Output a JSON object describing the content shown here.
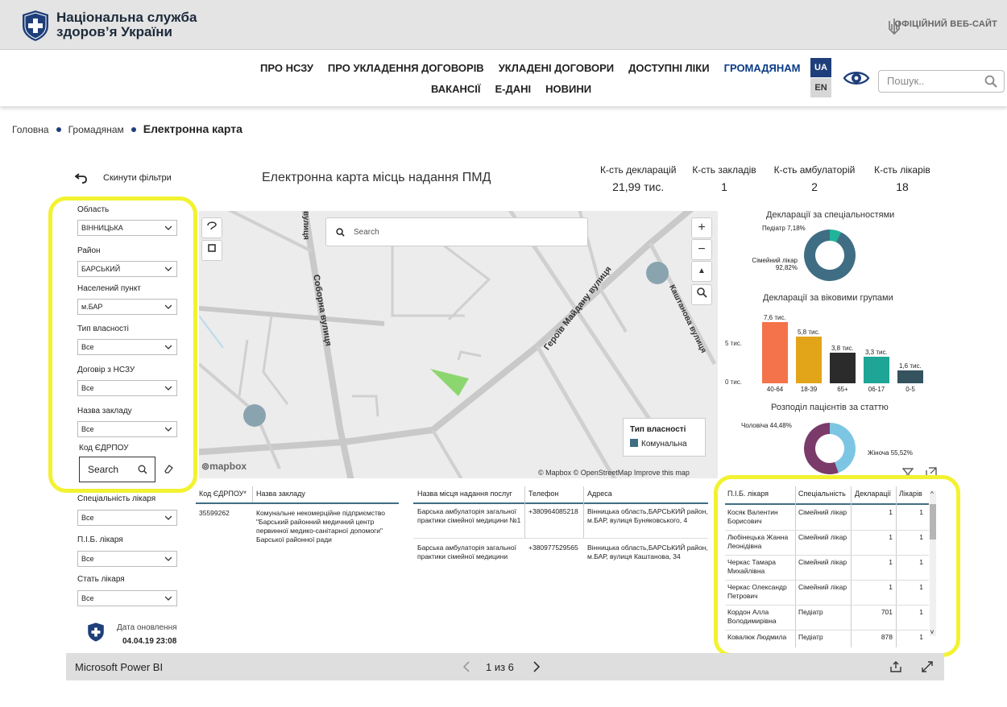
{
  "header": {
    "site_title_line1": "Національна служба",
    "site_title_line2": "здоров’я України",
    "official": "ОФІЦІЙНИЙ ВЕБ-САЙТ"
  },
  "nav": {
    "row1": [
      "ПРО НСЗУ",
      "ПРО УКЛАДЕННЯ ДОГОВОРІВ",
      "УКЛАДЕНІ ДОГОВОРИ",
      "ДОСТУПНІ ЛІКИ",
      "ГРОМАДЯНАМ"
    ],
    "row2": [
      "ВАКАНСІЇ",
      "Е-ДАНІ",
      "НОВИНИ"
    ],
    "lang_ua": "UA",
    "lang_en": "EN",
    "search_placeholder": "Пошук.."
  },
  "breadcrumb": [
    "Головна",
    "Громадянам",
    "Електронна карта"
  ],
  "report": {
    "title": "Електронна карта місць надання ПМД",
    "reset_label": "Скинути фільтри",
    "kpis": [
      {
        "label": "К-сть декларацій",
        "value": "21,99 тис."
      },
      {
        "label": "К-сть закладів",
        "value": "1"
      },
      {
        "label": "К-сть амбулаторій",
        "value": "2"
      },
      {
        "label": "К-сть лікарів",
        "value": "18"
      }
    ],
    "filters": [
      {
        "label": "Область",
        "value": "ВІННИЦЬКА"
      },
      {
        "label": "Район",
        "value": "БАРСЬКИЙ"
      },
      {
        "label": "Населений пункт",
        "value": "м.БАР"
      },
      {
        "label": "Тип власності",
        "value": "Все"
      },
      {
        "label": "Договір з НСЗУ",
        "value": "Все"
      },
      {
        "label": "Назва закладу",
        "value": "Все"
      }
    ],
    "edrpou": {
      "label": "Код ЄДРПОУ",
      "placeholder": "Search"
    },
    "doctor_filters": [
      {
        "label": "Спеціальність лікаря",
        "value": "Все"
      },
      {
        "label": "П.І.Б. лікаря",
        "value": "Все"
      },
      {
        "label": "Стать лікаря",
        "value": "Все"
      }
    ],
    "update": {
      "label": "Дата оновлення",
      "value": "04.04.19 23:08"
    }
  },
  "map": {
    "search_placeholder": "Search",
    "streets": [
      "Соборна вулиця",
      "Героїв Майдану вулиця",
      "Каштанова вулиця",
      "вулиця"
    ],
    "legend_title": "Тип власності",
    "legend_item": "Комунальна",
    "legend_color": "#3f6e84",
    "mapbox": "mapbox",
    "attribution": "© Mapbox © OpenStreetMap  Improve this map"
  },
  "facility_table": {
    "headers": [
      "Код ЄДРПОУ*",
      "Назва закладу"
    ],
    "rows": [
      {
        "code": "35599262",
        "name": "Комунальне некомерційне підприємство \"Барський районний медичний центр первинної медико-санітарної допомоги\" Барської районної ради"
      }
    ]
  },
  "location_table": {
    "headers": [
      "Назва місця надання послуг",
      "Телефон",
      "Адреса"
    ],
    "rows": [
      {
        "name": "Барська амбулаторія загальної практики сімейної медицини №1",
        "phone": "+380964085218",
        "address": "Вінницька область,БАРСЬКИЙ район, м.БАР, вулиця Буняковського, 4"
      },
      {
        "name": "Барська амбулаторія загальної практики сімейної медицини",
        "phone": "+380977529565",
        "address": "Вінницька область,БАРСЬКИЙ район, м.БАР, вулиця Каштанова, 34"
      }
    ]
  },
  "doctor_table": {
    "headers": [
      "П.І.Б. лікаря",
      "Спеціальність",
      "Декларації",
      "Лікарів"
    ],
    "rows": [
      {
        "name": "Косяк Валентин Борисович",
        "spec": "Сімейний лікар",
        "decl": "1",
        "doctors": "1"
      },
      {
        "name": "Любінецька Жанна Леонідівна",
        "spec": "Сімейний лікар",
        "decl": "1",
        "doctors": "1"
      },
      {
        "name": "Черкас Тамара Михайлівна",
        "spec": "Сімейний лікар",
        "decl": "1",
        "doctors": "1"
      },
      {
        "name": "Черкас Олександр Петрович",
        "spec": "Сімейний лікар",
        "decl": "1",
        "doctors": "1"
      },
      {
        "name": "Кордон Алла Володимирівна",
        "spec": "Педіатр",
        "decl": "701",
        "doctors": "1"
      },
      {
        "name": "Ковалюк Людмила",
        "spec": "Педіатр",
        "decl": "878",
        "doctors": "1"
      }
    ]
  },
  "chart_data": [
    {
      "type": "pie",
      "title": "Декларації за спеціальностями",
      "slices": [
        {
          "label": "Педіатр",
          "value": 7.18,
          "display": "Педіатр 7,18%",
          "color": "#1fb59a"
        },
        {
          "label": "Сімейний лікар",
          "value": 92.82,
          "display": "Сімейний лікар 92,82%",
          "color": "#3f6e84"
        }
      ]
    },
    {
      "type": "bar",
      "title": "Декларації за віковими групами",
      "categories": [
        "40-64",
        "18-39",
        "65+",
        "06-17",
        "0-5"
      ],
      "values": [
        7.6,
        5.8,
        3.8,
        3.3,
        1.6
      ],
      "labels": [
        "7,6 тис.",
        "5,8 тис.",
        "3,8 тис.",
        "3,3 тис.",
        "1,6 тис."
      ],
      "colors": [
        "#f4734a",
        "#e2a51a",
        "#2b2b2b",
        "#1ea596",
        "#35535f"
      ],
      "yticks": [
        "5 тис.",
        "0 тис."
      ],
      "ylim": [
        0,
        8
      ]
    },
    {
      "type": "pie",
      "title": "Розподіл пацієнтів за статтю",
      "slices": [
        {
          "label": "Чоловіча",
          "value": 44.48,
          "display": "Чоловіча 44,48%",
          "color": "#7cc6e4"
        },
        {
          "label": "Жіноча",
          "value": 55.52,
          "display": "Жіноча 55,52%",
          "color": "#7a3b6a"
        }
      ]
    }
  ],
  "powerbi": {
    "name": "Microsoft Power BI",
    "pager": "1 из 6"
  },
  "colors": {
    "highlight": "#f2f231",
    "brand": "#1f3f7a"
  }
}
